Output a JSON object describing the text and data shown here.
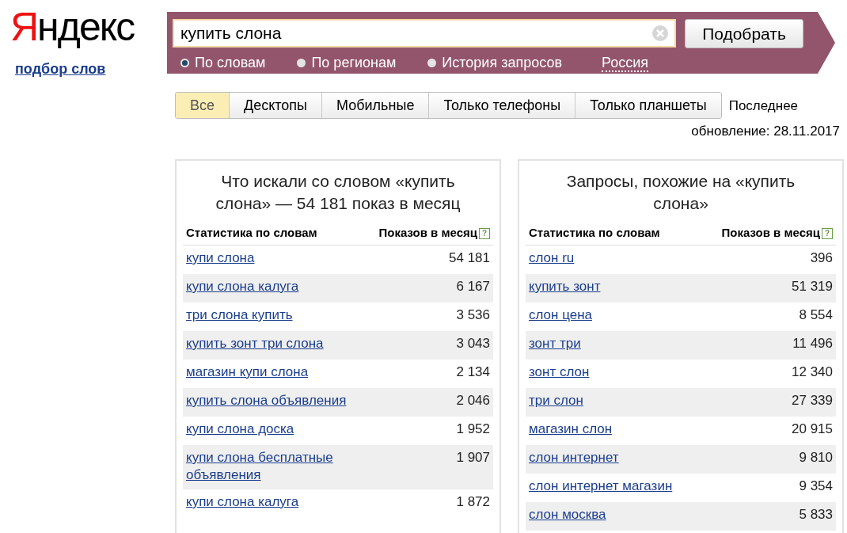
{
  "logo": "Яндекс",
  "service_link": "подбор слов",
  "search": {
    "value": "купить слона",
    "button": "Подобрать"
  },
  "modes": [
    {
      "label": "По словам",
      "selected": true
    },
    {
      "label": "По регионам",
      "selected": false
    },
    {
      "label": "История запросов",
      "selected": false
    }
  ],
  "region": "Россия",
  "tabs": [
    {
      "label": "Все",
      "selected": true
    },
    {
      "label": "Десктопы",
      "selected": false
    },
    {
      "label": "Мобильные",
      "selected": false
    },
    {
      "label": "Только телефоны",
      "selected": false
    },
    {
      "label": "Только планшеты",
      "selected": false
    }
  ],
  "update_label": "Последнее",
  "update_date": "обновление: 28.11.2017",
  "panels": [
    {
      "title": "Что искали со словом «купить слона» — 54 181 показ в месяц",
      "columns": [
        "Статистика по словам",
        "Показов в месяц"
      ],
      "help": "?",
      "rows": [
        {
          "query": "купи слона",
          "count": "54 181"
        },
        {
          "query": "купи слона калуга",
          "count": "6 167"
        },
        {
          "query": "три слона купить",
          "count": "3 536"
        },
        {
          "query": "купить зонт три слона",
          "count": "3 043"
        },
        {
          "query": "магазин купи слона",
          "count": "2 134"
        },
        {
          "query": "купить слона объявления",
          "count": "2 046"
        },
        {
          "query": "купи слона доска",
          "count": "1 952"
        },
        {
          "query": "купи слона бесплатные объявления",
          "count": "1 907"
        },
        {
          "query": "купи слона калуга",
          "count": "1 872"
        }
      ]
    },
    {
      "title": "Запросы, похожие на «купить слона»",
      "columns": [
        "Статистика по словам",
        "Показов в месяц"
      ],
      "help": "?",
      "rows": [
        {
          "query": "слон ru",
          "count": "396"
        },
        {
          "query": "купить зонт",
          "count": "51 319"
        },
        {
          "query": "слон цена",
          "count": "8 554"
        },
        {
          "query": "зонт три",
          "count": "11 496"
        },
        {
          "query": "зонт слон",
          "count": "12 340"
        },
        {
          "query": "три слон",
          "count": "27 339"
        },
        {
          "query": "магазин слон",
          "count": "20 915"
        },
        {
          "query": "слон интернет",
          "count": "9 810"
        },
        {
          "query": "слон интернет магазин",
          "count": "9 354"
        },
        {
          "query": "слон москва",
          "count": "5 833"
        }
      ]
    }
  ]
}
